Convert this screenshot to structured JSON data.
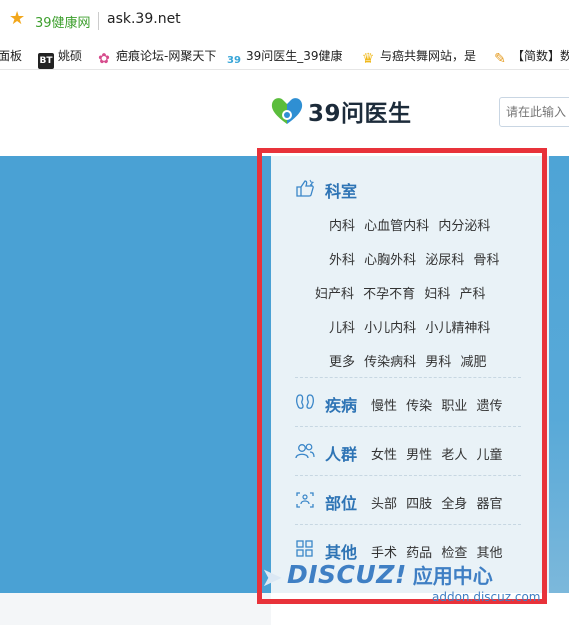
{
  "browser": {
    "tab_title": "39健康网",
    "url": "ask.39.net",
    "bookmarks": [
      {
        "label": "面板",
        "icon": "none"
      },
      {
        "label": "姚硕",
        "icon": "bt-icon"
      },
      {
        "label": "疤痕论坛-网聚天下",
        "icon": "flower-icon"
      },
      {
        "label": "39问医生_39健康",
        "icon": "39-icon"
      },
      {
        "label": "与癌共舞网站，是",
        "icon": "trophy-icon"
      },
      {
        "label": "【简数】数",
        "icon": "feather-icon"
      }
    ]
  },
  "header": {
    "logo_text": "39问医生",
    "search_placeholder": "请在此输入"
  },
  "panel": {
    "keshi": {
      "title": "科室",
      "rows": [
        [
          "内科",
          "心血管内科",
          "内分泌科"
        ],
        [
          "外科",
          "心胸外科",
          "泌尿科",
          "骨科"
        ],
        [
          "妇产科",
          "不孕不育",
          "妇科",
          "产科"
        ],
        [
          "儿科",
          "小儿内科",
          "小儿精神科"
        ],
        [
          "更多",
          "传染病科",
          "男科",
          "减肥"
        ]
      ]
    },
    "jibing": {
      "title": "疾病",
      "items": [
        "慢性",
        "传染",
        "职业",
        "遗传"
      ]
    },
    "renqun": {
      "title": "人群",
      "items": [
        "女性",
        "男性",
        "老人",
        "儿童"
      ]
    },
    "buwei": {
      "title": "部位",
      "items": [
        "头部",
        "四肢",
        "全身",
        "器官"
      ]
    },
    "qita": {
      "title": "其他",
      "items": [
        "手术",
        "药品",
        "检查",
        "其他"
      ]
    }
  },
  "watermark": {
    "brand": "DISCUZ!",
    "brand_cn": "应用中心",
    "url": "addon.discuz.com"
  },
  "colors": {
    "accent": "#2e74b5",
    "highlight_frame": "#e8323a",
    "banner": "#4aa1d4"
  }
}
